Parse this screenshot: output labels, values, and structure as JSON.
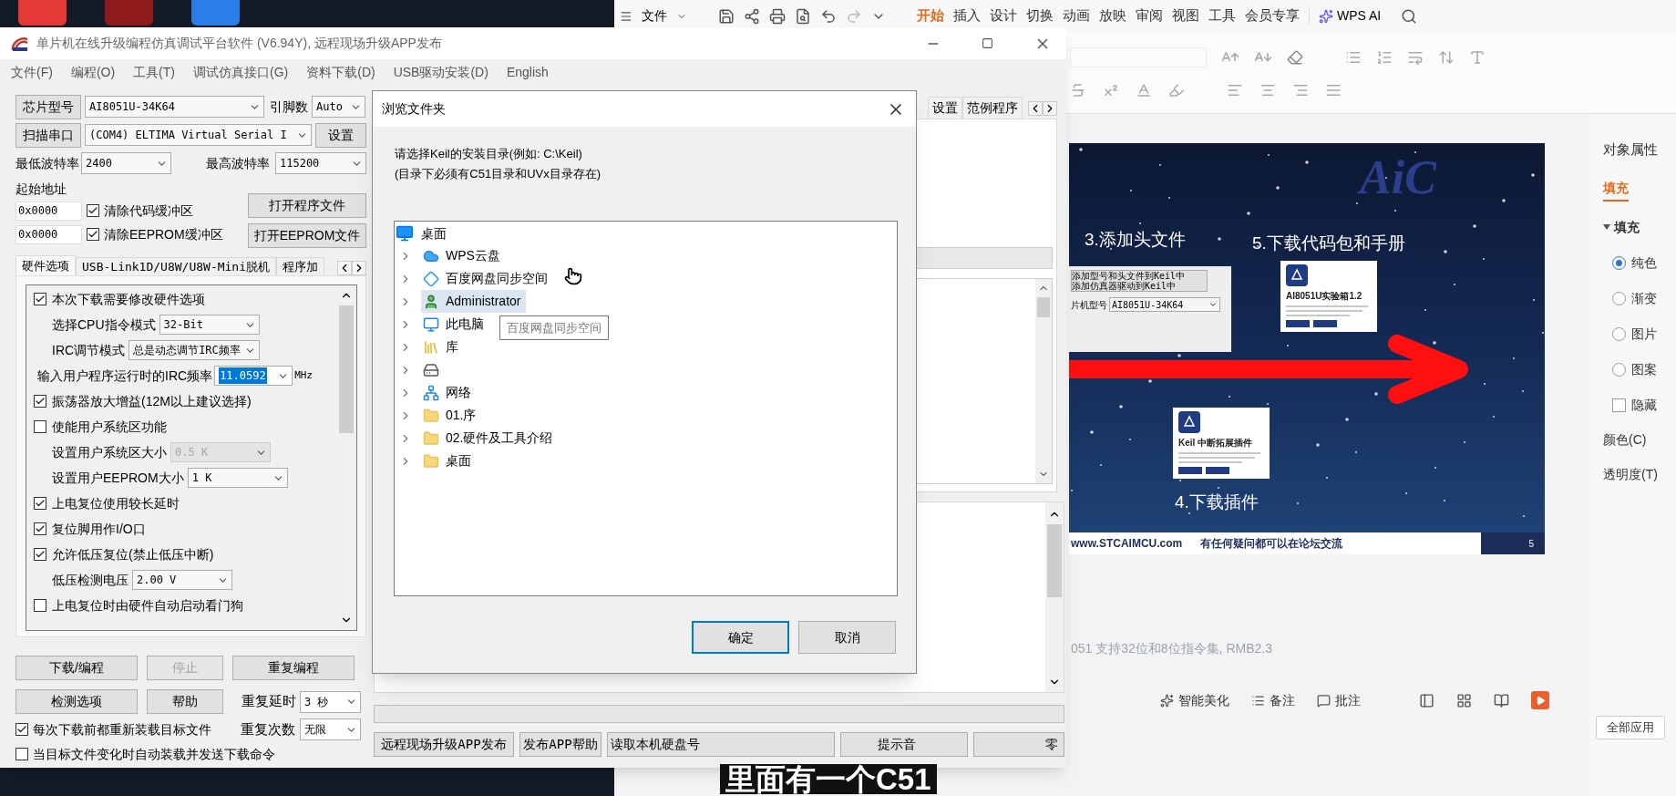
{
  "stc": {
    "title": "单片机在线升级编程仿真调试平台软件 (V6.94Y), 远程现场升级APP发布",
    "menu": [
      "文件(F)",
      "编程(O)",
      "工具(T)",
      "调试仿真接口(G)",
      "资料下载(D)",
      "USB驱动安装(D)",
      "English"
    ],
    "chip": {
      "button": "芯片型号",
      "value": "AI8051U-34K64",
      "pins_label": "引脚数",
      "pins_value": "Auto"
    },
    "port": {
      "button": "扫描串口",
      "value": "(COM4) ELTIMA Virtual Serial I",
      "settings_button": "设置"
    },
    "baud": {
      "min_label": "最低波特率",
      "min_value": "2400",
      "max_label": "最高波特率",
      "max_value": "115200"
    },
    "start_address_label": "起始地址",
    "address_rows": [
      {
        "value": "0x0000",
        "label": "清除代码缓冲区",
        "checked": true,
        "button": "打开程序文件"
      },
      {
        "value": "0x0000",
        "label": "清除EEPROM缓冲区",
        "checked": true,
        "button": "打开EEPROM文件"
      }
    ],
    "option_tabs": [
      {
        "label": "硬件选项",
        "selected": true
      },
      {
        "label": "USB-Link1D/U8W/U8W-Mini脱机",
        "selected": false
      },
      {
        "label": "程序加",
        "selected": false
      }
    ],
    "hardware_options": [
      {
        "kind": "checkbox",
        "label": "本次下载需要修改硬件选项",
        "checked": true
      },
      {
        "kind": "select",
        "label": "选择CPU指令模式",
        "value": "32-Bit",
        "disabled": false
      },
      {
        "kind": "select",
        "label": "IRC调节模式",
        "value": "总是动态调节IRC频率",
        "disabled": false
      },
      {
        "kind": "entry",
        "label": "输入用户程序运行时的IRC频率",
        "value": "11.0592",
        "unit": "MHz",
        "value_selected": true
      },
      {
        "kind": "checkbox",
        "label": "振荡器放大增益(12M以上建议选择)",
        "checked": true
      },
      {
        "kind": "checkbox",
        "label": "使能用户系统区功能",
        "checked": false
      },
      {
        "kind": "select",
        "label": "设置用户系统区大小",
        "value": "0.5 K",
        "disabled": true
      },
      {
        "kind": "select",
        "label": "设置用户EEPROM大小",
        "value": "1 K",
        "disabled": false
      },
      {
        "kind": "checkbox",
        "label": "上电复位使用较长延时",
        "checked": true
      },
      {
        "kind": "checkbox",
        "label": "复位脚用作I/O口",
        "checked": true
      },
      {
        "kind": "checkbox",
        "label": "允许低压复位(禁止低压中断)",
        "checked": true
      },
      {
        "kind": "select",
        "label": "低压检测电压",
        "value": "2.00 V",
        "disabled": false
      },
      {
        "kind": "checkbox",
        "label": "上电复位时由硬件自动启动看门狗",
        "checked": false
      }
    ],
    "action_buttons": [
      {
        "label": "下载/编程",
        "disabled": false
      },
      {
        "label": "停止",
        "disabled": true
      },
      {
        "label": "重复编程",
        "disabled": false
      },
      {
        "label": "检测选项",
        "disabled": false
      },
      {
        "label": "帮助",
        "disabled": false
      }
    ],
    "repeat_delay": {
      "label": "重复延时",
      "value": "3 秒"
    },
    "repeat_count": {
      "label": "重复次数",
      "value": "无限"
    },
    "bottom_checks": [
      {
        "label": "每次下载前都重新装载目标文件",
        "checked": true
      },
      {
        "label": "当目标文件变化时自动装载并发送下载命令",
        "checked": false
      }
    ],
    "progress": {
      "level": 0
    },
    "right_tabs": [
      {
        "label": "设置",
        "selected": false
      },
      {
        "label": "范例程序",
        "selected": false
      }
    ],
    "footer_buttons": [
      "远程现场升级APP发布",
      "发布APP帮助",
      "读取本机硬盘号",
      "提示音",
      "零"
    ]
  },
  "folder_dialog": {
    "title": "浏览文件夹",
    "instructions": [
      "请选择Keil的安装目录(例如: C:\\Keil)",
      "(目录下必须有C51目录和UVx目录存在)"
    ],
    "root": "桌面",
    "items": [
      {
        "kind": "cloud",
        "label": "WPS云盘",
        "selected": false
      },
      {
        "kind": "sync",
        "label": "百度网盘同步空间",
        "selected": false
      },
      {
        "kind": "user",
        "label": "Administrator",
        "selected": true
      },
      {
        "kind": "computer",
        "label": "此电脑",
        "selected": false
      },
      {
        "kind": "library",
        "label": "库",
        "selected": false
      },
      {
        "kind": "drive",
        "selected": false
      },
      {
        "kind": "network",
        "label": "网络",
        "selected": false
      },
      {
        "kind": "folder",
        "label": "01.序",
        "selected": false
      },
      {
        "kind": "folder",
        "label": "02.硬件及工具介绍",
        "selected": false
      },
      {
        "kind": "folder",
        "label": "桌面",
        "selected": false
      }
    ],
    "tooltip": "百度网盘同步空间",
    "buttons": [
      {
        "label": "确定",
        "default": true
      },
      {
        "label": "取消",
        "default": false
      }
    ]
  },
  "wps": {
    "file_menu": "文件",
    "ribbon_tabs": [
      {
        "label": "开始",
        "selected": true
      },
      {
        "label": "插入",
        "selected": false
      },
      {
        "label": "设计",
        "selected": false
      },
      {
        "label": "切换",
        "selected": false
      },
      {
        "label": "动画",
        "selected": false
      },
      {
        "label": "放映",
        "selected": false
      },
      {
        "label": "审阅",
        "selected": false
      },
      {
        "label": "视图",
        "selected": false
      },
      {
        "label": "工具",
        "selected": false
      },
      {
        "label": "会员专享",
        "selected": false
      }
    ],
    "ai_label": "WPS AI",
    "slide": {
      "logo": "AiC",
      "heading_header": "3.添加头文件",
      "heading_download": "5.下载代码包和手册",
      "heading_plugin": "4.下载插件",
      "inset": {
        "buttons": [
          "添加型号和头文件到Keil中",
          "添加仿真器驱动到Keil中"
        ],
        "label": "片机型号",
        "value": "AI8051U-34K64"
      },
      "cards": [
        {
          "title": "AI8051U实验箱1.2"
        },
        {
          "title": "Keil 中断拓展插件"
        }
      ],
      "footer": {
        "site": "www.STCAIMCU.com",
        "note": "有任何疑问都可以在论坛交流",
        "page": "5"
      }
    },
    "notes": "051  支持32位和8位指令集, RMB2.3",
    "properties": {
      "title": "对象属性",
      "tab": "填充",
      "section": "填充",
      "options": [
        {
          "kind": "radio",
          "label": "纯色",
          "selected": true
        },
        {
          "kind": "radio",
          "label": "渐变",
          "selected": false
        },
        {
          "kind": "radio",
          "label": "图片",
          "selected": false
        },
        {
          "kind": "radio",
          "label": "图案",
          "selected": false
        },
        {
          "kind": "checkbox",
          "label": "隐藏",
          "checked": false
        }
      ],
      "fields": [
        "颜色(C)",
        "透明度(T)"
      ],
      "apply_all": "全部应用"
    },
    "status": [
      "智能美化",
      "备注",
      "批注"
    ]
  },
  "subtitle": "里面有一个C51"
}
